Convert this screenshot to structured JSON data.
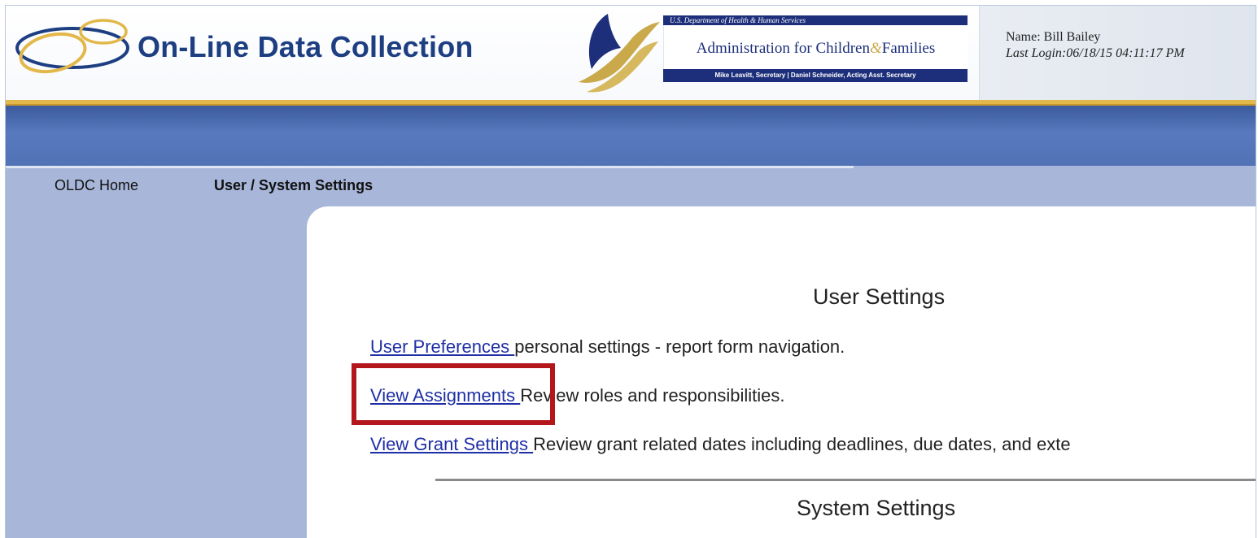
{
  "header": {
    "app_title": "On-Line Data Collection",
    "acf_top_text": "U.S. Department of Health & Human Services",
    "acf_name_left": "Administration for Children",
    "acf_name_amp": "&",
    "acf_name_right": "Families",
    "acf_bottom_text": "Mike Leavitt, Secretary  |  Daniel Schneider, Acting Asst. Secretary",
    "user_name": "Name: Bill Bailey",
    "last_login": "Last Login:06/18/15 04:11:17 PM"
  },
  "nav": {
    "home_label": "OLDC Home",
    "settings_label": "User / System Settings"
  },
  "content": {
    "user_settings_title": "User Settings",
    "rows": [
      {
        "link": "User Preferences ",
        "desc": "personal settings - report form navigation."
      },
      {
        "link": "View Assignments ",
        "desc": "Review roles and responsibilities."
      },
      {
        "link": "View Grant Settings ",
        "desc": "Review grant related dates including deadlines, due dates, and exte"
      }
    ],
    "system_settings_title": "System Settings"
  },
  "colors": {
    "title_blue": "#1d3f82",
    "band_blue": "#5879bf",
    "nav_bg": "#a8b7d9",
    "gold": "#e2b84a",
    "link_blue": "#1f2fa6",
    "highlight_red": "#b3171b"
  }
}
